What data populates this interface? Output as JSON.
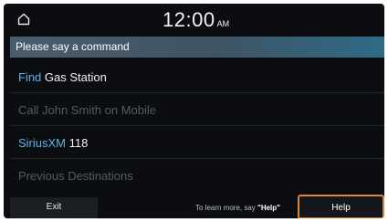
{
  "status": {
    "home_icon": "home-icon",
    "time": "12:00",
    "ampm": "AM"
  },
  "prompt": "Please say a command",
  "commands": [
    {
      "keyword": "Find",
      "rest": "Gas Station",
      "enabled": true
    },
    {
      "keyword": "",
      "rest": "Call John Smith on Mobile",
      "enabled": false
    },
    {
      "keyword": "SiriusXM",
      "rest": "118",
      "enabled": true
    },
    {
      "keyword": "",
      "rest": "Previous Destinations",
      "enabled": false
    }
  ],
  "footer": {
    "exit_label": "Exit",
    "hint_prefix": "To learn more, say ",
    "hint_keyword": "\"Help\"",
    "help_label": "Help"
  },
  "colors": {
    "keyword": "#5fb3e6",
    "help_border": "#d9873f",
    "prompt_bar": "#3f5463"
  }
}
